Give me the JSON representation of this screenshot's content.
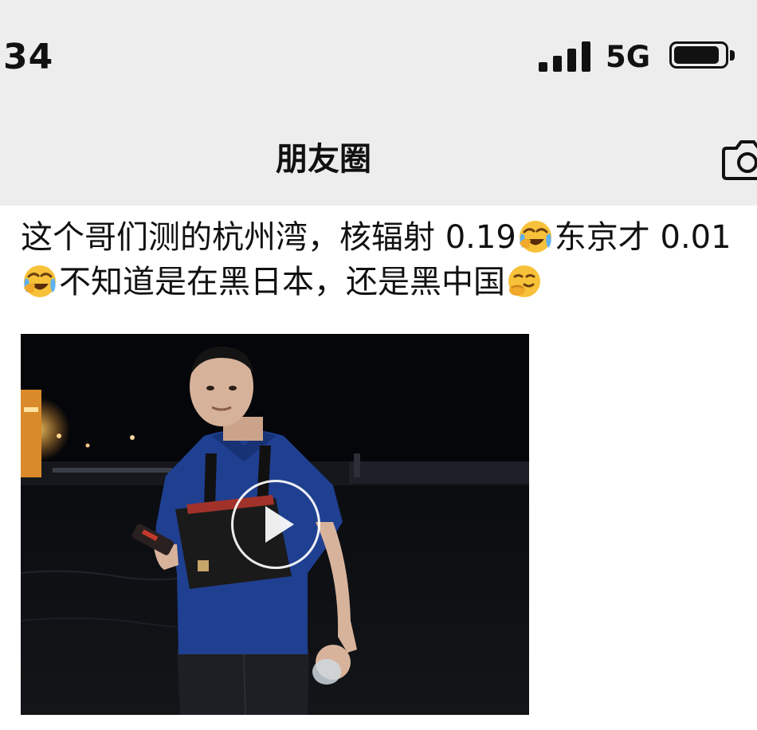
{
  "status_bar": {
    "time": "34",
    "network": "5G",
    "signal_bars": 4,
    "battery_level": 0.9
  },
  "nav": {
    "title": "朋友圈",
    "camera_icon": "camera-icon"
  },
  "post": {
    "text_parts": [
      "这个哥们测的杭州湾，核辐射 0.19",
      "东京才 0.01",
      "不知道是在黑日本，还是黑中国"
    ],
    "emojis": [
      "laugh-cry-emoji",
      "laugh-cry-emoji",
      "smirk-face-emoji"
    ]
  },
  "video": {
    "play_icon": "play-icon"
  },
  "colors": {
    "header_bg": "#ededed",
    "page_bg": "#ffffff",
    "text": "#111111",
    "emoji_yellow": "#f7c23a",
    "shirt_blue": "#1f3f91"
  }
}
